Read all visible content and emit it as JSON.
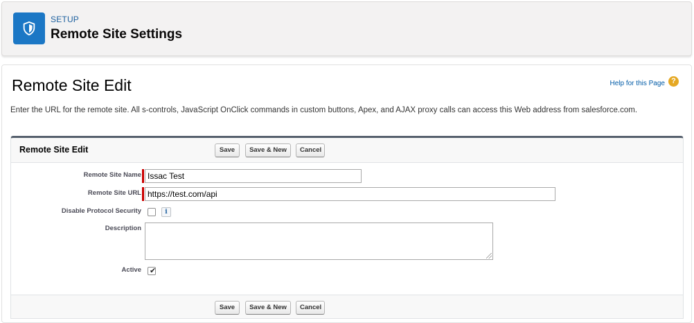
{
  "header": {
    "eyebrow": "SETUP",
    "title": "Remote Site Settings",
    "icon": "shield-icon",
    "icon_color": "#1b77c5"
  },
  "page": {
    "title": "Remote Site Edit",
    "help_link": "Help for this Page",
    "help_icon": "?",
    "intro": "Enter the URL for the remote site. All s-controls, JavaScript OnClick commands in custom buttons, Apex, and AJAX proxy calls can access this Web address from salesforce.com."
  },
  "block": {
    "title": "Remote Site Edit",
    "buttons": {
      "save": "Save",
      "save_new": "Save & New",
      "cancel": "Cancel"
    }
  },
  "form": {
    "remote_site_name": {
      "label": "Remote Site Name",
      "value": "Issac Test",
      "required": true
    },
    "remote_site_url": {
      "label": "Remote Site URL",
      "value": "https://test.com/api",
      "required": true
    },
    "disable_protocol_security": {
      "label": "Disable Protocol Security",
      "checked": false,
      "info_icon": "i"
    },
    "description": {
      "label": "Description",
      "value": ""
    },
    "active": {
      "label": "Active",
      "checked": true
    }
  },
  "colors": {
    "required_marker": "#c00000",
    "link": "#015ba7",
    "block_border": "#56606d"
  }
}
